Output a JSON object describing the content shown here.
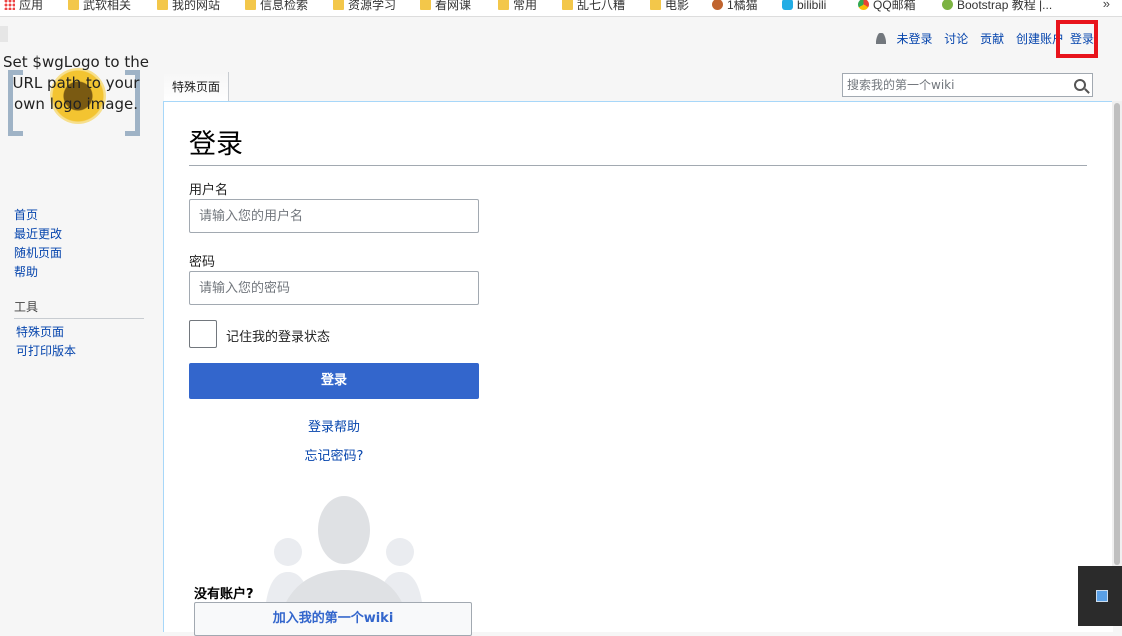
{
  "bookmarks": [
    "应用",
    "武软相关",
    "我的网站",
    "信息检索",
    "资源学习",
    "看网课",
    "常用",
    "乱七八糟",
    "电影",
    "1橘猫",
    "bilibili",
    "QQ邮箱",
    "Bootstrap 教程 |...",
    "»"
  ],
  "logo": {
    "text": "Set $wgLogo to the URL path to your own logo image."
  },
  "sidebar": {
    "nav": [
      "首页",
      "最近更改",
      "随机页面",
      "帮助"
    ],
    "tools_heading": "工具",
    "tools": [
      "特殊页面",
      "可打印版本"
    ]
  },
  "personal": {
    "not_logged_in": "未登录",
    "talk": "讨论",
    "contributions": "贡献",
    "create_account": "创建账户",
    "login": "登录"
  },
  "tabs": {
    "special": "特殊页面"
  },
  "search": {
    "placeholder": "搜索我的第一个wiki"
  },
  "form": {
    "title": "登录",
    "username_label": "用户名",
    "username_placeholder": "请输入您的用户名",
    "password_label": "密码",
    "password_placeholder": "请输入您的密码",
    "remember_label": "记住我的登录状态",
    "submit": "登录",
    "help": "登录帮助",
    "forgot": "忘记密码?",
    "no_account": "没有账户?",
    "join": "加入我的第一个wiki"
  },
  "colors": {
    "accent": "#3366cc",
    "link": "#0645ad",
    "highlight": "#e8141c"
  }
}
